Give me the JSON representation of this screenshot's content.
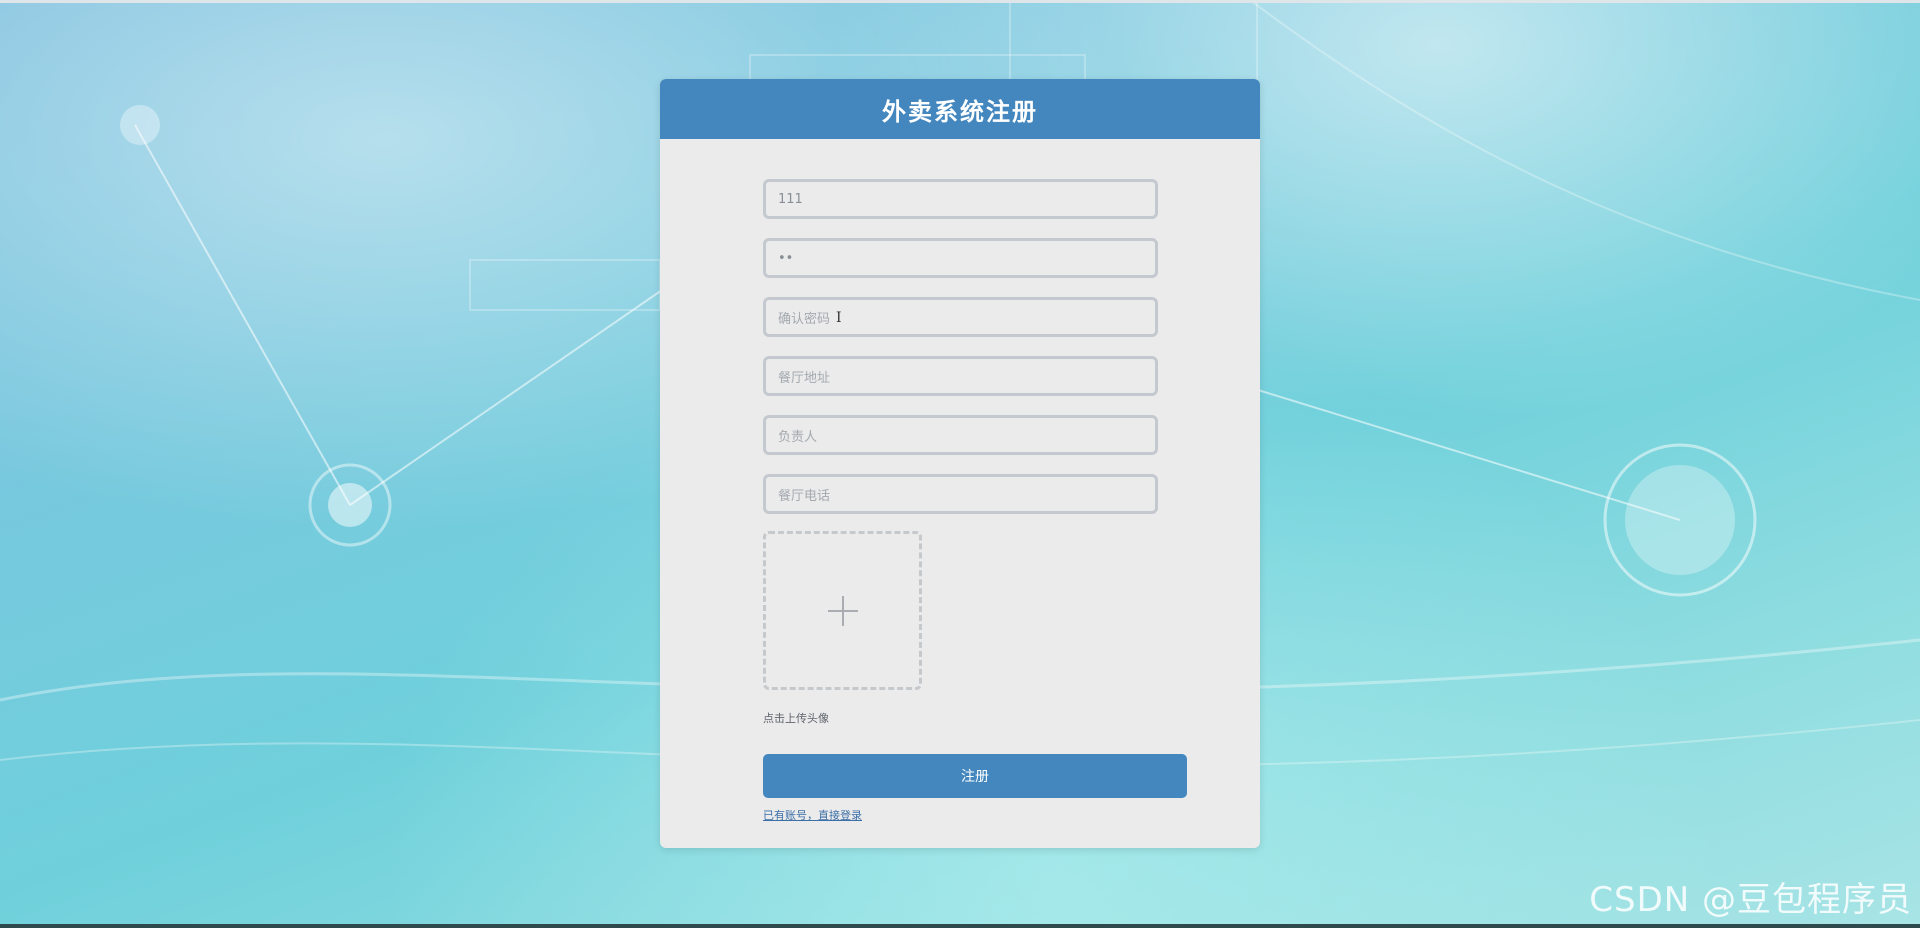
{
  "header": {
    "title": "外卖系统注册"
  },
  "form": {
    "fields": [
      {
        "name": "username",
        "value": "111",
        "placeholder": ""
      },
      {
        "name": "password",
        "value": "••",
        "placeholder": ""
      },
      {
        "name": "confirm_password",
        "value": "",
        "placeholder": "确认密码"
      },
      {
        "name": "address",
        "value": "",
        "placeholder": "餐厅地址"
      },
      {
        "name": "contact_person",
        "value": "",
        "placeholder": "负责人"
      },
      {
        "name": "phone",
        "value": "",
        "placeholder": "餐厅电话"
      }
    ],
    "upload_label": "点击上传头像",
    "submit_label": "注册",
    "login_link": "已有账号，直接登录"
  },
  "watermark": "CSDN @豆包程序员",
  "colors": {
    "accent": "#4387be",
    "card": "#ebebec",
    "field_border": "#c4c9cf"
  },
  "icons": {
    "upload": "plus-icon",
    "text_cursor": "i-beam-cursor-icon"
  }
}
